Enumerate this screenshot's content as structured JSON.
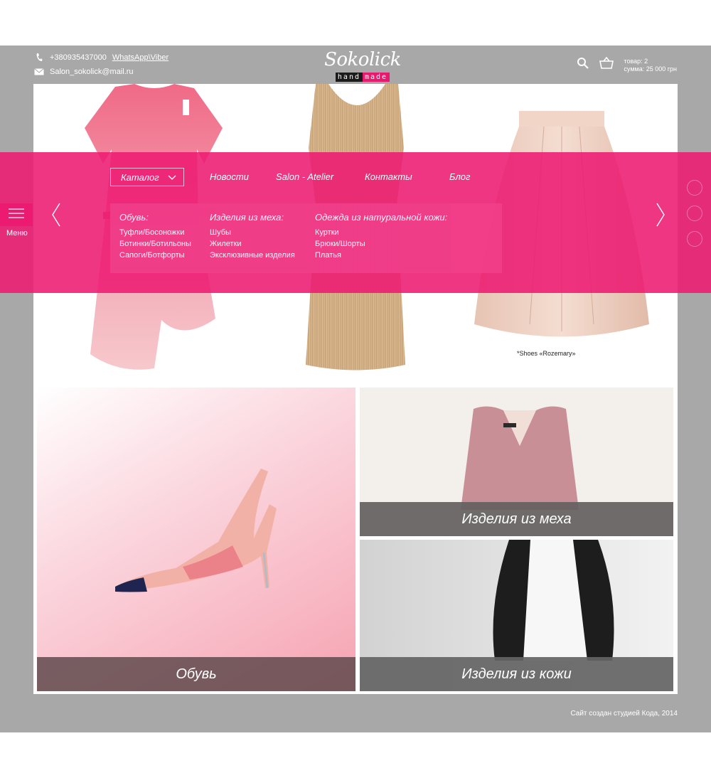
{
  "header": {
    "phone": "+380935437000",
    "messengers": "WhatsApp\\Viber",
    "email": "Salon_sokolick@mail.ru",
    "logo_script": "Sokolick",
    "logo_sub_a": "hand",
    "logo_sub_b": "made",
    "cart_count": "товар: 2",
    "cart_sum": "сумма: 25 000 грн"
  },
  "nav": {
    "catalog": "Каталог",
    "links": [
      "Новости",
      "Salon - Atelier",
      "Контакты",
      "Блог"
    ]
  },
  "submenu": {
    "columns": [
      {
        "title": "Обувь:",
        "items": [
          "Туфли/Босоножки",
          "Ботинки/Ботильоны",
          "Сапоги/Ботфорты"
        ]
      },
      {
        "title": "Изделия из меха:",
        "items": [
          "Шубы",
          "Жилетки",
          "Эксклюзивные изделия"
        ]
      },
      {
        "title": "Одежда из натуральной кожи:",
        "items": [
          "Куртки",
          "Брюки/Шорты",
          "Платья"
        ]
      }
    ]
  },
  "side_menu": {
    "label": "Меню"
  },
  "hero": {
    "note": "*Shoes «Rozemary»"
  },
  "tiles": {
    "shoes": "Обувь",
    "fur": "Изделия из меха",
    "leather": "Изделия из кожи"
  },
  "footer": {
    "credit": "Сайт создан студией Кода, 2014"
  },
  "colors": {
    "accent": "#ed1a72",
    "frame": "#a8a8a8"
  }
}
